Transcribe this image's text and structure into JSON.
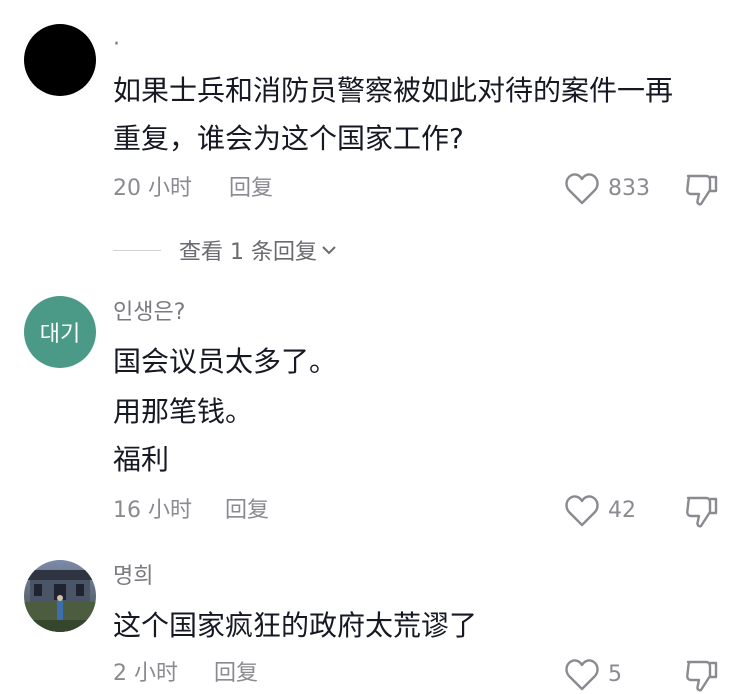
{
  "comments": [
    {
      "username": "·",
      "avatar_color": "#000000",
      "lines": [
        "如果士兵和消防员警察被如此对待的案件一再",
        "重复，谁会为这个国家工作?"
      ],
      "time": "20 小时",
      "reply_label": "回复",
      "likes": "833",
      "view_replies": "查看 1 条回复"
    },
    {
      "username": "인생은?",
      "avatar_color": "#4a9a87",
      "avatar_text": "대기",
      "lines": [
        "国会议员太多了。",
        "用那笔钱。",
        "福利"
      ],
      "time": "16 小时",
      "reply_label": "回复",
      "likes": "42"
    },
    {
      "username": "명희",
      "lines": [
        "这个国家疯狂的政府太荒谬了"
      ],
      "time": "2 小时",
      "reply_label": "回复",
      "likes": "5"
    }
  ]
}
